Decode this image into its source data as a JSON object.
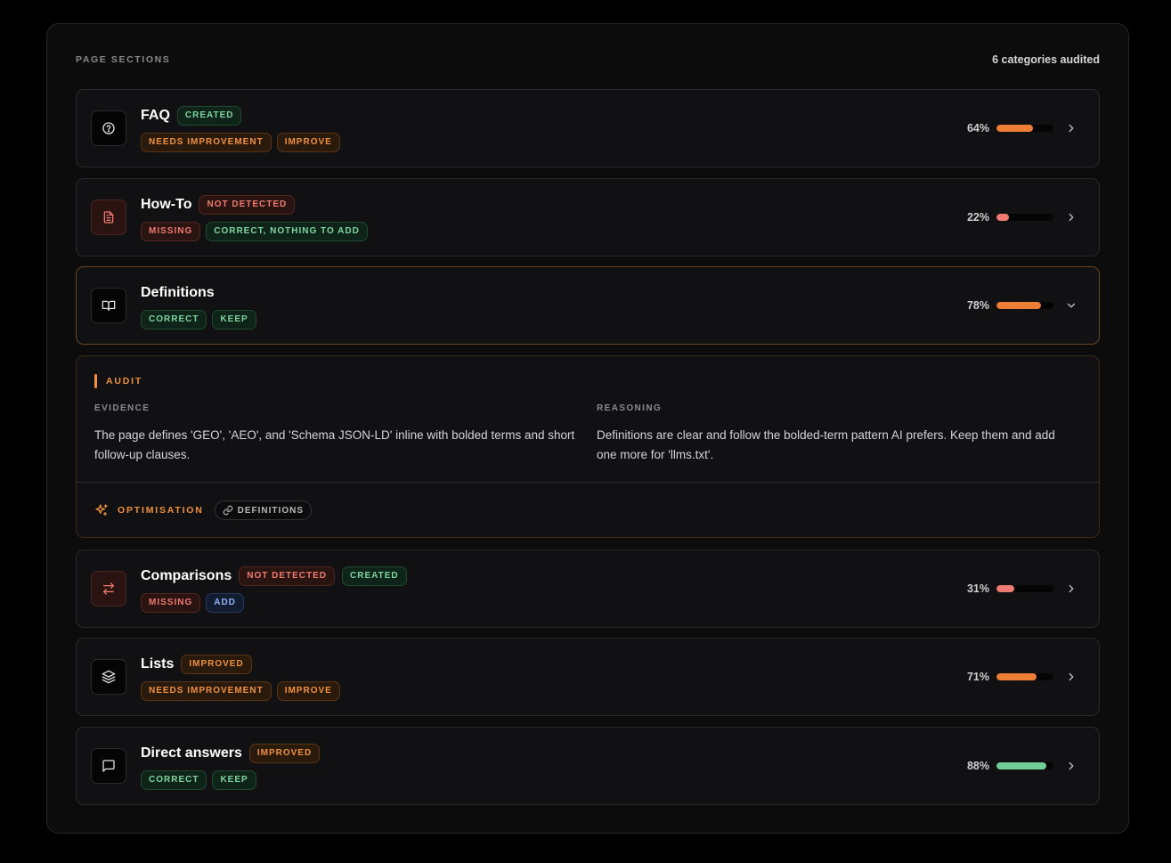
{
  "header": {
    "section_label": "PAGE SECTIONS",
    "count_label": "6 categories audited"
  },
  "colors": {
    "orange": "#f0913f",
    "red": "#f07a6f",
    "green": "#7ed4a0",
    "blue": "#8fb3f5"
  },
  "rows": [
    {
      "title": "FAQ",
      "icon": "question-circle-icon",
      "status": [
        {
          "label": "CREATED",
          "tone": "green"
        }
      ],
      "tags": [
        {
          "label": "NEEDS IMPROVEMENT",
          "tone": "orange"
        },
        {
          "label": "IMPROVE",
          "tone": "orange"
        }
      ],
      "score": 64,
      "score_label": "64%",
      "bar_color": "#ee7d35",
      "expanded": false
    },
    {
      "title": "How-To",
      "icon": "document-icon",
      "status": [
        {
          "label": "NOT DETECTED",
          "tone": "red"
        }
      ],
      "tags": [
        {
          "label": "MISSING",
          "tone": "red"
        },
        {
          "label": "CORRECT, NOTHING TO ADD",
          "tone": "green"
        }
      ],
      "score": 22,
      "score_label": "22%",
      "bar_color": "#ef7b72",
      "expanded": false
    },
    {
      "title": "Definitions",
      "icon": "open-book-icon",
      "status": [],
      "tags": [
        {
          "label": "CORRECT",
          "tone": "green"
        },
        {
          "label": "KEEP",
          "tone": "green"
        }
      ],
      "score": 78,
      "score_label": "78%",
      "bar_color": "#ee7d35",
      "expanded": true
    },
    {
      "title": "Comparisons",
      "icon": "swap-arrows-icon",
      "status": [
        {
          "label": "NOT DETECTED",
          "tone": "red"
        },
        {
          "label": "CREATED",
          "tone": "green"
        }
      ],
      "tags": [
        {
          "label": "MISSING",
          "tone": "red"
        },
        {
          "label": "ADD",
          "tone": "blue"
        }
      ],
      "score": 31,
      "score_label": "31%",
      "bar_color": "#ef7b72",
      "expanded": false
    },
    {
      "title": "Lists",
      "icon": "layers-icon",
      "status": [
        {
          "label": "IMPROVED",
          "tone": "orange"
        }
      ],
      "tags": [
        {
          "label": "NEEDS IMPROVEMENT",
          "tone": "orange"
        },
        {
          "label": "IMPROVE",
          "tone": "orange"
        }
      ],
      "score": 71,
      "score_label": "71%",
      "bar_color": "#ee7d35",
      "expanded": false
    },
    {
      "title": "Direct answers",
      "icon": "chat-bubble-icon",
      "status": [
        {
          "label": "IMPROVED",
          "tone": "orange"
        }
      ],
      "tags": [
        {
          "label": "CORRECT",
          "tone": "green"
        },
        {
          "label": "KEEP",
          "tone": "green"
        }
      ],
      "score": 88,
      "score_label": "88%",
      "bar_color": "#6fcf94",
      "expanded": false
    }
  ],
  "audit": {
    "title": "AUDIT",
    "evidence_label": "EVIDENCE",
    "evidence_text": "The page defines 'GEO', 'AEO', and 'Schema JSON-LD' inline with bolded terms and short follow-up clauses.",
    "reasoning_label": "REASONING",
    "reasoning_text": "Definitions are clear and follow the bolded-term pattern AI prefers. Keep them and add one more for 'llms.txt'.",
    "optimisation_label": "OPTIMISATION",
    "chip_label": "DEFINITIONS"
  }
}
